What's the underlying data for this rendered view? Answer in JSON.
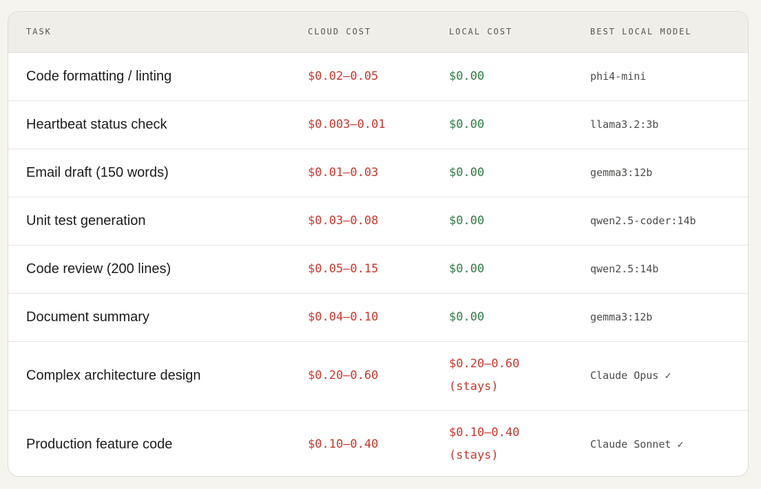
{
  "headers": {
    "task": "TASK",
    "cloud": "CLOUD COST",
    "local": "LOCAL COST",
    "model": "BEST LOCAL MODEL"
  },
  "rows": [
    {
      "task": "Code formatting / linting",
      "cloud": "$0.02–0.05",
      "local": "$0.00",
      "local_note": "",
      "local_status": "free",
      "model": "phi4-mini"
    },
    {
      "task": "Heartbeat status check",
      "cloud": "$0.003–0.01",
      "local": "$0.00",
      "local_note": "",
      "local_status": "free",
      "model": "llama3.2:3b"
    },
    {
      "task": "Email draft (150 words)",
      "cloud": "$0.01–0.03",
      "local": "$0.00",
      "local_note": "",
      "local_status": "free",
      "model": "gemma3:12b"
    },
    {
      "task": "Unit test generation",
      "cloud": "$0.03–0.08",
      "local": "$0.00",
      "local_note": "",
      "local_status": "free",
      "model": "qwen2.5-coder:14b"
    },
    {
      "task": "Code review (200 lines)",
      "cloud": "$0.05–0.15",
      "local": "$0.00",
      "local_note": "",
      "local_status": "free",
      "model": "qwen2.5:14b"
    },
    {
      "task": "Document summary",
      "cloud": "$0.04–0.10",
      "local": "$0.00",
      "local_note": "",
      "local_status": "free",
      "model": "gemma3:12b"
    },
    {
      "task": "Complex architecture design",
      "cloud": "$0.20–0.60",
      "local": "$0.20–0.60",
      "local_note": "(stays)",
      "local_status": "cost",
      "model": "Claude Opus ✓"
    },
    {
      "task": "Production feature code",
      "cloud": "$0.10–0.40",
      "local": "$0.10–0.40",
      "local_note": "(stays)",
      "local_status": "cost",
      "model": "Claude Sonnet ✓"
    }
  ],
  "colors": {
    "cloud_cost": "#c8372d",
    "local_free": "#2f7a47",
    "local_cost": "#c8372d"
  }
}
